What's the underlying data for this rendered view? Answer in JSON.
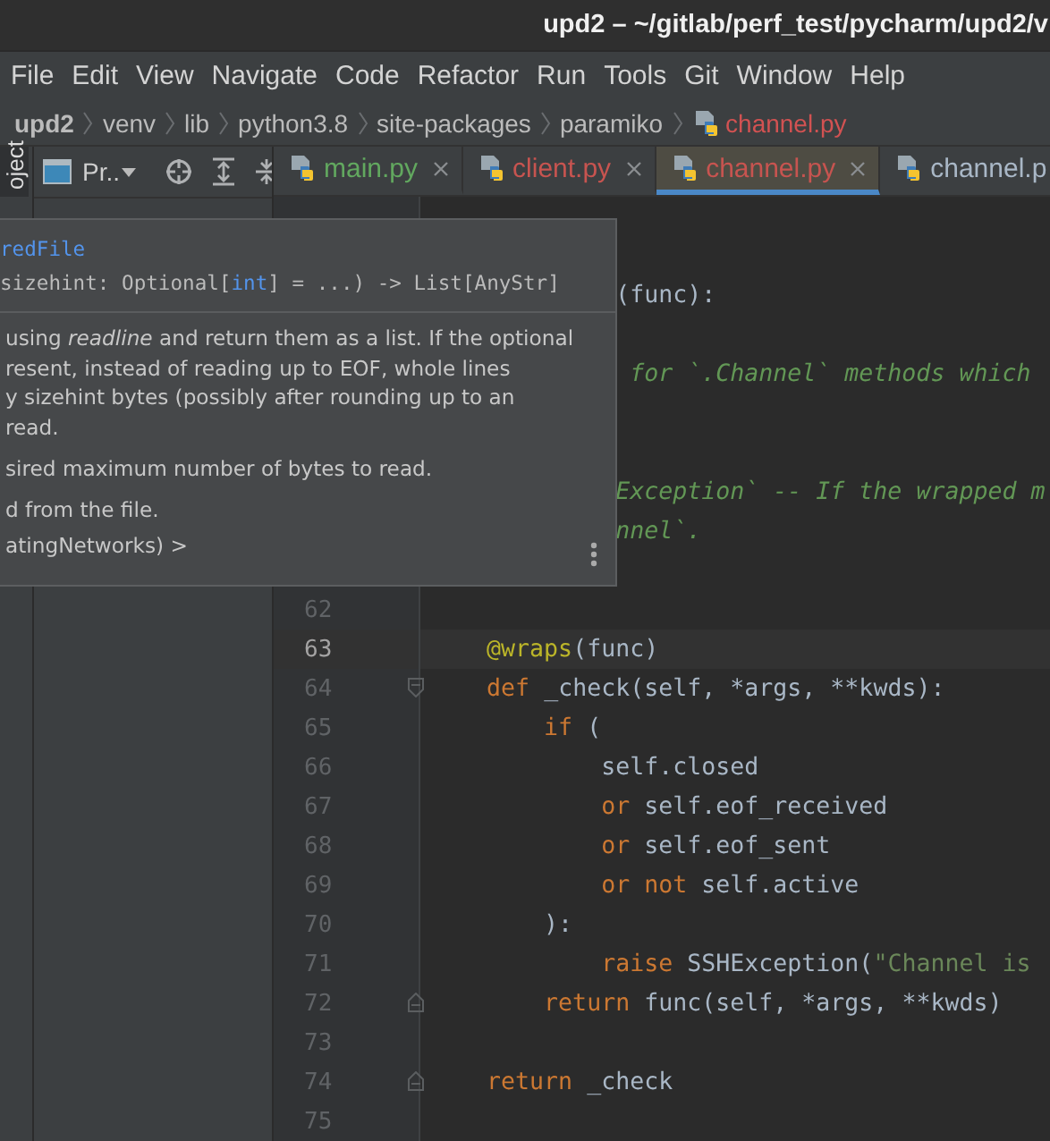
{
  "window": {
    "title": "upd2 – ~/gitlab/perf_test/pycharm/upd2/v"
  },
  "menu": [
    "File",
    "Edit",
    "View",
    "Navigate",
    "Code",
    "Refactor",
    "Run",
    "Tools",
    "Git",
    "Window",
    "Help"
  ],
  "breadcrumbs": [
    {
      "label": "upd2",
      "kind": "root"
    },
    {
      "label": "venv",
      "kind": "folder"
    },
    {
      "label": "lib",
      "kind": "folder"
    },
    {
      "label": "python3.8",
      "kind": "folder"
    },
    {
      "label": "site-packages",
      "kind": "folder"
    },
    {
      "label": "paramiko",
      "kind": "folder"
    },
    {
      "label": "channel.py",
      "kind": "file"
    }
  ],
  "side_stripe": {
    "label": "oject"
  },
  "project_panel": {
    "title": "Pr.."
  },
  "tabs": [
    {
      "label": "main.py",
      "color": "#62a85f",
      "selected": false
    },
    {
      "label": "client.py",
      "color": "#c75450",
      "selected": false
    },
    {
      "label": "channel.py",
      "color": "#c75450",
      "selected": true
    },
    {
      "label": "channel.p",
      "color": "#a9b7c6",
      "selected": false
    }
  ],
  "editor": {
    "lines_behind_popup": [
      {
        "kind": "blank"
      },
      {
        "kind": "blank"
      },
      {
        "kind": "code",
        "tokens": [
          {
            "kind": "plain",
            "text": "             (func):"
          }
        ]
      },
      {
        "kind": "blank"
      },
      {
        "kind": "code",
        "tokens": [
          {
            "kind": "doc",
            "text": "              for `.Channel` methods which"
          }
        ]
      },
      {
        "kind": "blank"
      },
      {
        "kind": "blank"
      },
      {
        "kind": "code",
        "tokens": [
          {
            "kind": "doc",
            "text": "             Exception` -- If the wrapped m"
          }
        ]
      },
      {
        "kind": "code",
        "tokens": [
          {
            "kind": "doc",
            "text": "             nnel`."
          }
        ]
      },
      {
        "kind": "blank"
      }
    ],
    "lines": [
      {
        "number": "62",
        "current": false
      },
      {
        "number": "63",
        "current": true,
        "tokens": [
          {
            "kind": "deco",
            "text": "    @wraps"
          },
          {
            "kind": "plain",
            "text": "(func)"
          }
        ]
      },
      {
        "number": "64",
        "current": false,
        "kind": "fold-start",
        "tokens": [
          {
            "kind": "keyword",
            "text": "    def"
          },
          {
            "kind": "plain",
            "text": " _check(self, *args, **kwds):"
          }
        ]
      },
      {
        "number": "65",
        "current": false,
        "tokens": [
          {
            "kind": "keyword",
            "text": "        if"
          },
          {
            "kind": "plain",
            "text": " ("
          }
        ]
      },
      {
        "number": "66",
        "current": false,
        "tokens": [
          {
            "kind": "plain",
            "text": "            self.closed"
          }
        ]
      },
      {
        "number": "67",
        "current": false,
        "tokens": [
          {
            "kind": "keyword",
            "text": "            or"
          },
          {
            "kind": "plain",
            "text": " self.eof_received"
          }
        ]
      },
      {
        "number": "68",
        "current": false,
        "tokens": [
          {
            "kind": "keyword",
            "text": "            or"
          },
          {
            "kind": "plain",
            "text": " self.eof_sent"
          }
        ]
      },
      {
        "number": "69",
        "current": false,
        "tokens": [
          {
            "kind": "keyword",
            "text": "            or not"
          },
          {
            "kind": "plain",
            "text": " self.active"
          }
        ]
      },
      {
        "number": "70",
        "current": false,
        "tokens": [
          {
            "kind": "plain",
            "text": "        ):"
          }
        ]
      },
      {
        "number": "71",
        "current": false,
        "tokens": [
          {
            "kind": "keyword",
            "text": "            raise"
          },
          {
            "kind": "plain",
            "text": " SSHException("
          },
          {
            "kind": "string",
            "text": "\"Channel is"
          }
        ]
      },
      {
        "number": "72",
        "current": false,
        "kind": "fold-end",
        "tokens": [
          {
            "kind": "keyword",
            "text": "        return"
          },
          {
            "kind": "plain",
            "text": " func(self, *args, **kwds)"
          }
        ]
      },
      {
        "number": "73",
        "current": false
      },
      {
        "number": "74",
        "current": false,
        "kind": "fold-end",
        "tokens": [
          {
            "kind": "keyword",
            "text": "    return"
          },
          {
            "kind": "plain",
            "text": " _check"
          }
        ]
      },
      {
        "number": "75",
        "current": false
      }
    ]
  },
  "doc_popup": {
    "signature": [
      [
        {
          "kind": "name",
          "text": "redFile"
        }
      ],
      [
        {
          "kind": "plain",
          "text": "sizehint: Optional["
        },
        {
          "kind": "name",
          "text": "int"
        },
        {
          "kind": "plain",
          "text": "] = ...) -> List[AnyStr]"
        }
      ]
    ],
    "body": [
      "using *readline* and return them as a list. If the optional",
      "resent, instead of reading up to EOF, whole lines",
      "y sizehint bytes (possibly after rounding up to an",
      "read.",
      "sired maximum number of bytes to read.",
      "d from the file.",
      "atingNetworks) >"
    ]
  }
}
